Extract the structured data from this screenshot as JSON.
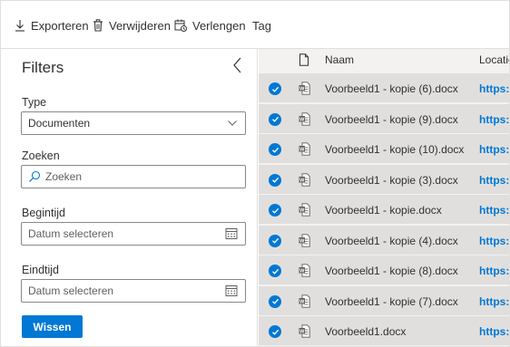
{
  "toolbar": {
    "export_label": "Exporteren",
    "delete_label": "Verwijderen",
    "extend_label": "Verlengen",
    "tag_label": "Tag"
  },
  "filters": {
    "title": "Filters",
    "type_label": "Type",
    "type_value": "Documenten",
    "search_label": "Zoeken",
    "search_placeholder": "Zoeken",
    "start_label": "Begintijd",
    "start_placeholder": "Datum selecteren",
    "end_label": "Eindtijd",
    "end_placeholder": "Datum selecteren",
    "clear_label": "Wissen"
  },
  "grid": {
    "col_name": "Naam",
    "col_location": "Locatie",
    "rows": [
      {
        "name": "Voorbeeld1 - kopie (6).docx",
        "location": "https://"
      },
      {
        "name": "Voorbeeld1 - kopie (9).docx",
        "location": "https://"
      },
      {
        "name": "Voorbeeld1 - kopie (10).docx",
        "location": "https://"
      },
      {
        "name": "Voorbeeld1 - kopie (3).docx",
        "location": "https://"
      },
      {
        "name": "Voorbeeld1 - kopie.docx",
        "location": "https://"
      },
      {
        "name": "Voorbeeld1 - kopie (4).docx",
        "location": "https://"
      },
      {
        "name": "Voorbeeld1 - kopie (8).docx",
        "location": "https://"
      },
      {
        "name": "Voorbeeld1 - kopie (7).docx",
        "location": "https://"
      },
      {
        "name": "Voorbeeld1.docx",
        "location": "https://"
      }
    ]
  },
  "colors": {
    "accent": "#0078d4",
    "row_selected": "#e1dfdd",
    "panel_bg": "#f3f2f1"
  }
}
